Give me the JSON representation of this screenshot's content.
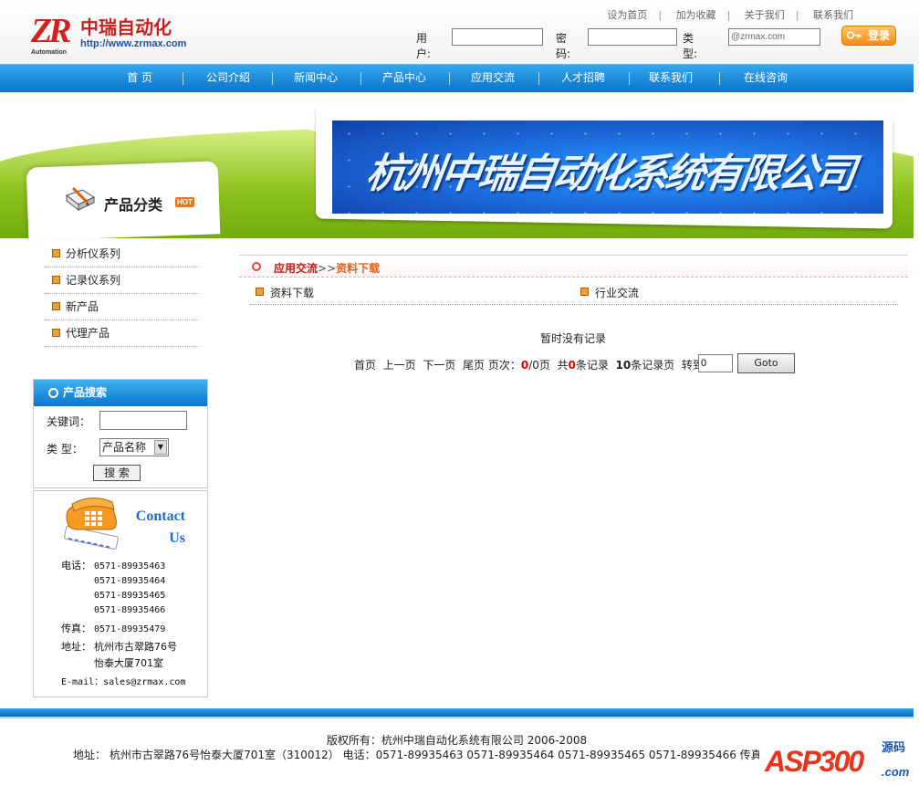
{
  "logo": {
    "letters": "ZR",
    "name": "中瑞自动化",
    "url": "http://www.zrmax.com",
    "tag": "Automation"
  },
  "top_links": [
    "设为首页",
    "加为收藏",
    "关于我们",
    "联系我们"
  ],
  "login": {
    "user_label": "用户:",
    "password_label": "密码:",
    "type_label": "类型:",
    "type_placeholder": "@zrmax.com",
    "login_button": "登录"
  },
  "nav": [
    "首  页",
    "公司介绍",
    "新闻中心",
    "产品中心",
    "应用交流",
    "人才招聘",
    "联系我们",
    "在线咨询"
  ],
  "banner_title": "杭州中瑞自动化系统有限公司",
  "sidebar": {
    "category_title": "产品分类",
    "hot_badge": "HOT",
    "categories": [
      "分析仪系列",
      "记录仪系列",
      "新产品",
      "代理产品"
    ],
    "search": {
      "title": "产品搜索",
      "keyword_label": "关键词：",
      "type_label": "类  型：",
      "type_value": "产品名称",
      "button": "搜 索"
    },
    "contact": {
      "title_line1": "Contact",
      "title_line2": "Us",
      "phone_label": "电话：",
      "phones": [
        "0571-89935463",
        "0571-89935464",
        "0571-89935465",
        "0571-89935466"
      ],
      "fax_label": "传真：",
      "fax": "0571-89935479",
      "address_label": "地址：",
      "address_line1": "杭州市古翠路76号",
      "address_line2": "怡泰大厦701室",
      "email_label": "E-mail：",
      "email": "sales@zrmax.com"
    }
  },
  "main": {
    "breadcrumb_section": "应用交流",
    "breadcrumb_sep": ">>",
    "breadcrumb_current": "资料下载",
    "subcategories": [
      "资料下载",
      "行业交流"
    ],
    "empty_message": "暂时没有记录",
    "pager": {
      "first": "首页",
      "prev": "上一页",
      "next": "下一页",
      "last": "尾页",
      "page_label": "页次：",
      "current_page": "0",
      "total_pages": "/0页",
      "total_prefix": "共",
      "total_count": "0",
      "total_suffix": "条记录",
      "per_page": "10",
      "per_page_suffix": "条记录页",
      "goto_label": "转到：",
      "goto_value": "0",
      "goto_button": "Goto"
    }
  },
  "footer": {
    "copyright": "版权所有：杭州中瑞自动化系统有限公司  2006-2008",
    "address_line": "地址： 杭州市古翠路76号怡泰大厦701室（310012） 电话：0571-89935463  0571-89935464  0571-89935465  0571-89935466  传真：",
    "logo_text": "ASP300",
    "logo_sub": "源码",
    "logo_com": ".com"
  },
  "colors": {
    "nav_blue": "#0c72c8",
    "accent_red": "#c81818",
    "banner_green": "#8cc21c"
  }
}
